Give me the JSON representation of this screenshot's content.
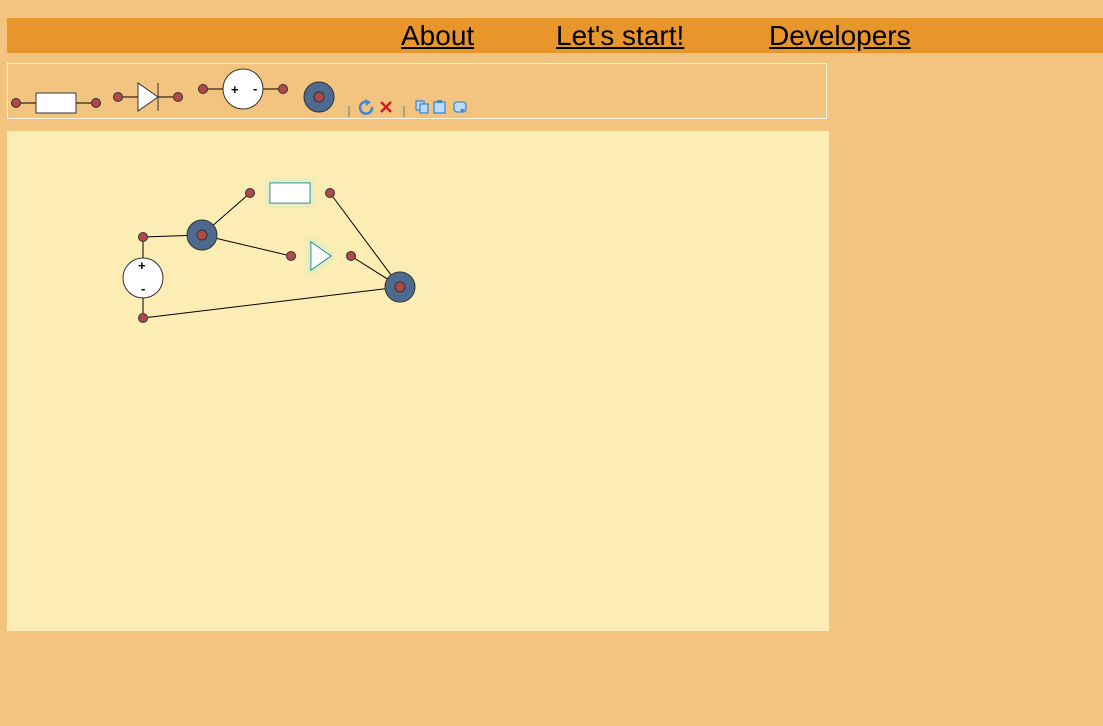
{
  "nav": {
    "about": "About",
    "start": "Let's start!",
    "developers": "Developers"
  },
  "palette": {
    "items": [
      {
        "name": "resistor-tool",
        "icon": "resistor-icon"
      },
      {
        "name": "diode-tool",
        "icon": "diode-icon"
      },
      {
        "name": "voltage-source-tool",
        "icon": "voltage-source-icon"
      },
      {
        "name": "node-tool",
        "icon": "node-icon"
      }
    ],
    "voltage_source_plus": "+",
    "voltage_source_minus": "-",
    "actions": [
      {
        "name": "rotate-button",
        "icon": "rotate-icon"
      },
      {
        "name": "delete-button",
        "icon": "delete-icon"
      },
      {
        "name": "copy-button",
        "icon": "copy-icon"
      },
      {
        "name": "paste-button",
        "icon": "paste-icon"
      },
      {
        "name": "refresh-button",
        "icon": "refresh-icon"
      }
    ]
  },
  "circuit": {
    "source_plus": "+",
    "source_minus": "-",
    "selected_components": [
      "resistor",
      "diode"
    ]
  },
  "colors": {
    "page_bg": "#f3c47f",
    "topbar": "#e8952c",
    "canvas_bg": "#fbedb4",
    "terminal": "#b04a4a",
    "node_fill": "#4f6a8f",
    "selection_glow": "#3fe0d0"
  }
}
